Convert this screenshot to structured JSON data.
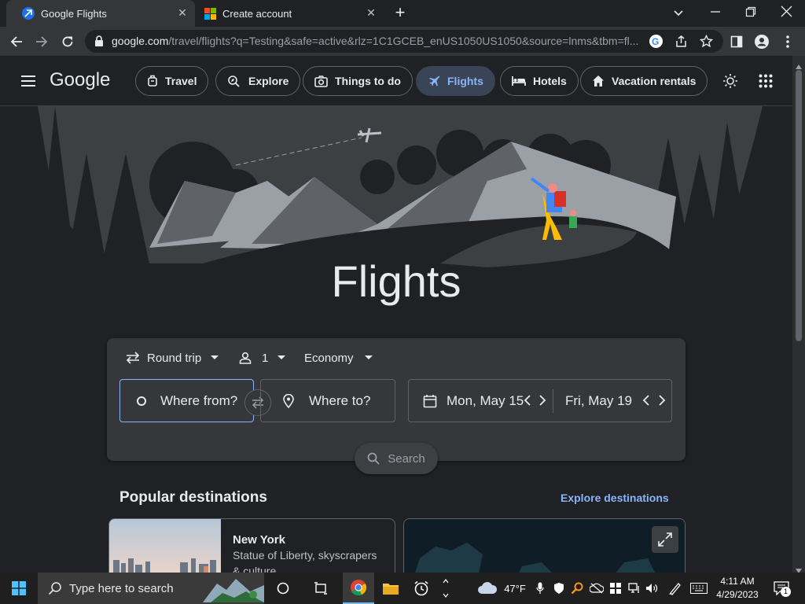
{
  "browser": {
    "tabs": [
      {
        "title": "Google Flights",
        "active": true,
        "icon": "google-flights-favicon"
      },
      {
        "title": "Create account",
        "active": false,
        "icon": "microsoft-favicon"
      }
    ],
    "new_tab": "+",
    "url_host": "google.com",
    "url_rest": "/travel/flights?q=Testing&safe=active&rlz=1C1GCEB_enUS1050US1050&source=lnms&tbm=fl..."
  },
  "header": {
    "logo": "Google",
    "nav": [
      {
        "label": "Travel",
        "icon": "suitcase-icon",
        "active": false
      },
      {
        "label": "Explore",
        "icon": "explore-icon",
        "active": false
      },
      {
        "label": "Things to do",
        "icon": "camera-icon",
        "active": false
      },
      {
        "label": "Flights",
        "icon": "airplane-icon",
        "active": true
      },
      {
        "label": "Hotels",
        "icon": "bed-icon",
        "active": false
      },
      {
        "label": "Vacation rentals",
        "icon": "house-icon",
        "active": false
      }
    ]
  },
  "hero": {
    "title": "Flights"
  },
  "search": {
    "trip_type": "Round trip",
    "passengers": "1",
    "cabin_class": "Economy",
    "from_placeholder": "Where from?",
    "to_placeholder": "Where to?",
    "depart_date": "Mon, May 15",
    "return_date": "Fri, May 19",
    "search_label": "Search"
  },
  "popular": {
    "title": "Popular destinations",
    "explore_link": "Explore destinations",
    "cards": [
      {
        "name": "New York",
        "description": "Statue of Liberty, skyscrapers",
        "description_more": "& culture"
      }
    ]
  },
  "taskbar": {
    "search_placeholder": "Type here to search",
    "weather": "47°F",
    "time": "4:11 AM",
    "date": "4/29/2023",
    "notifications": "1"
  },
  "colors": {
    "accent": "#8ab4f8",
    "background": "#202124",
    "card": "#36373a"
  }
}
